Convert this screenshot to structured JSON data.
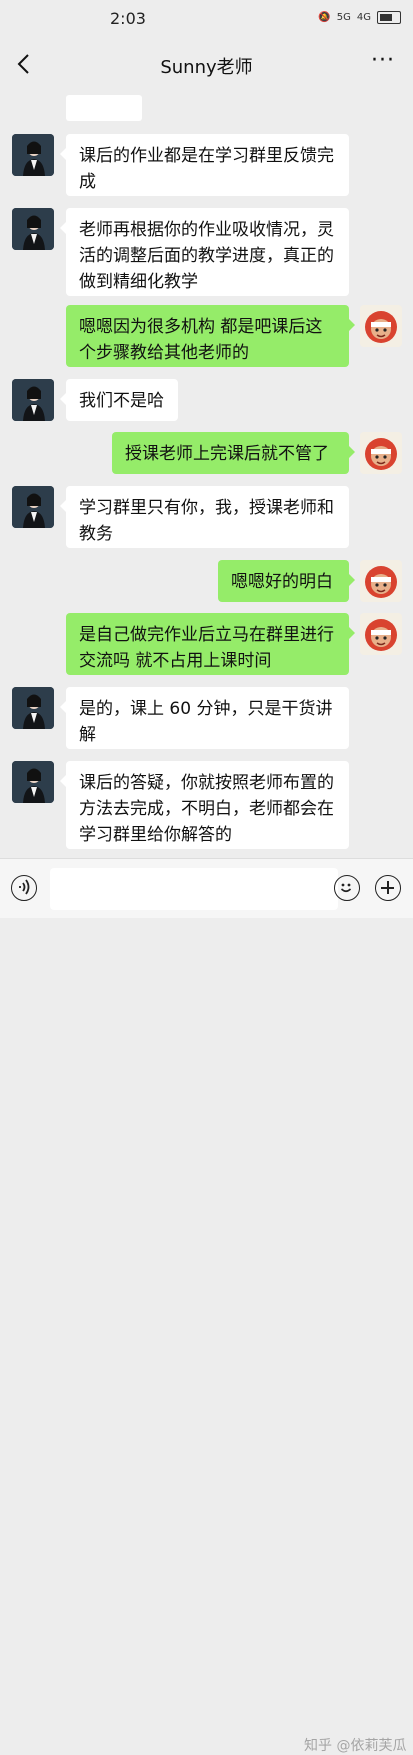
{
  "status_bar": {
    "time": "2:03",
    "signal_1": "5G",
    "signal_2": "4G"
  },
  "header": {
    "title": "Sunny老师"
  },
  "messages": [
    {
      "side": "left",
      "text": "课后的作业都是在学习群里反馈完成"
    },
    {
      "side": "left",
      "text": "老师再根据你的作业吸收情况，灵活的调整后面的教学进度，真正的做到精细化教学"
    },
    {
      "side": "right",
      "text": "嗯嗯因为很多机构 都是吧课后这个步骤教给其他老师的"
    },
    {
      "side": "left",
      "text": "我们不是哈"
    },
    {
      "side": "right",
      "text": "授课老师上完课后就不管了"
    },
    {
      "side": "left",
      "text": "学习群里只有你，我，授课老师和教务"
    },
    {
      "side": "right",
      "text": "嗯嗯好的明白"
    },
    {
      "side": "right",
      "text": "是自己做完作业后立马在群里进行交流吗 就不占用上课时间"
    },
    {
      "side": "left",
      "text": "是的，课上 60 分钟，只是干货讲解"
    },
    {
      "side": "left",
      "text": "课后的答疑，你就按照老师布置的方法去完成，不明白，老师都会在学习群里给你解答的"
    }
  ],
  "input_bar": {
    "placeholder": ""
  },
  "watermark": "知乎 @依莉芙瓜",
  "icons": {
    "back": "back-arrow-icon",
    "more": "more-dots-icon",
    "voice": "voice-icon",
    "emoji": "emoji-icon",
    "plus": "plus-icon"
  }
}
